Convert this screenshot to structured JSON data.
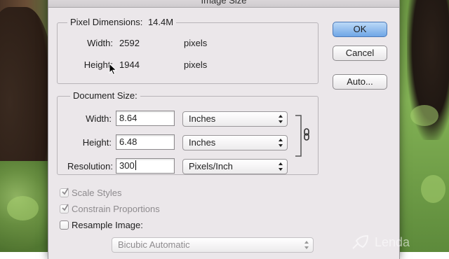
{
  "dialog": {
    "title": "Image Size",
    "pixel_dimensions": {
      "legend": "Pixel Dimensions:",
      "size": "14.4M",
      "width_label": "Width:",
      "width_value": "2592",
      "width_unit": "pixels",
      "height_label": "Height:",
      "height_value": "1944",
      "height_unit": "pixels"
    },
    "document_size": {
      "legend": "Document Size:",
      "width_label": "Width:",
      "width_value": "8.64",
      "width_unit": "Inches",
      "height_label": "Height:",
      "height_value": "6.48",
      "height_unit": "Inches",
      "resolution_label": "Resolution:",
      "resolution_value": "300",
      "resolution_unit": "Pixels/Inch"
    },
    "options": {
      "scale_styles": {
        "label": "Scale Styles",
        "checked": true,
        "enabled": false
      },
      "constrain_proportions": {
        "label": "Constrain Proportions",
        "checked": true,
        "enabled": false
      },
      "resample_image": {
        "label": "Resample Image:",
        "checked": false,
        "enabled": true
      },
      "resample_method": "Bicubic Automatic"
    },
    "buttons": {
      "ok": "OK",
      "cancel": "Cancel",
      "auto": "Auto..."
    }
  },
  "watermark": {
    "text": "Lenda"
  },
  "icons": [
    "chain-link-icon",
    "mouse-cursor-icon",
    "checkmark-icon",
    "select-arrows-icon",
    "rocket-icon"
  ]
}
